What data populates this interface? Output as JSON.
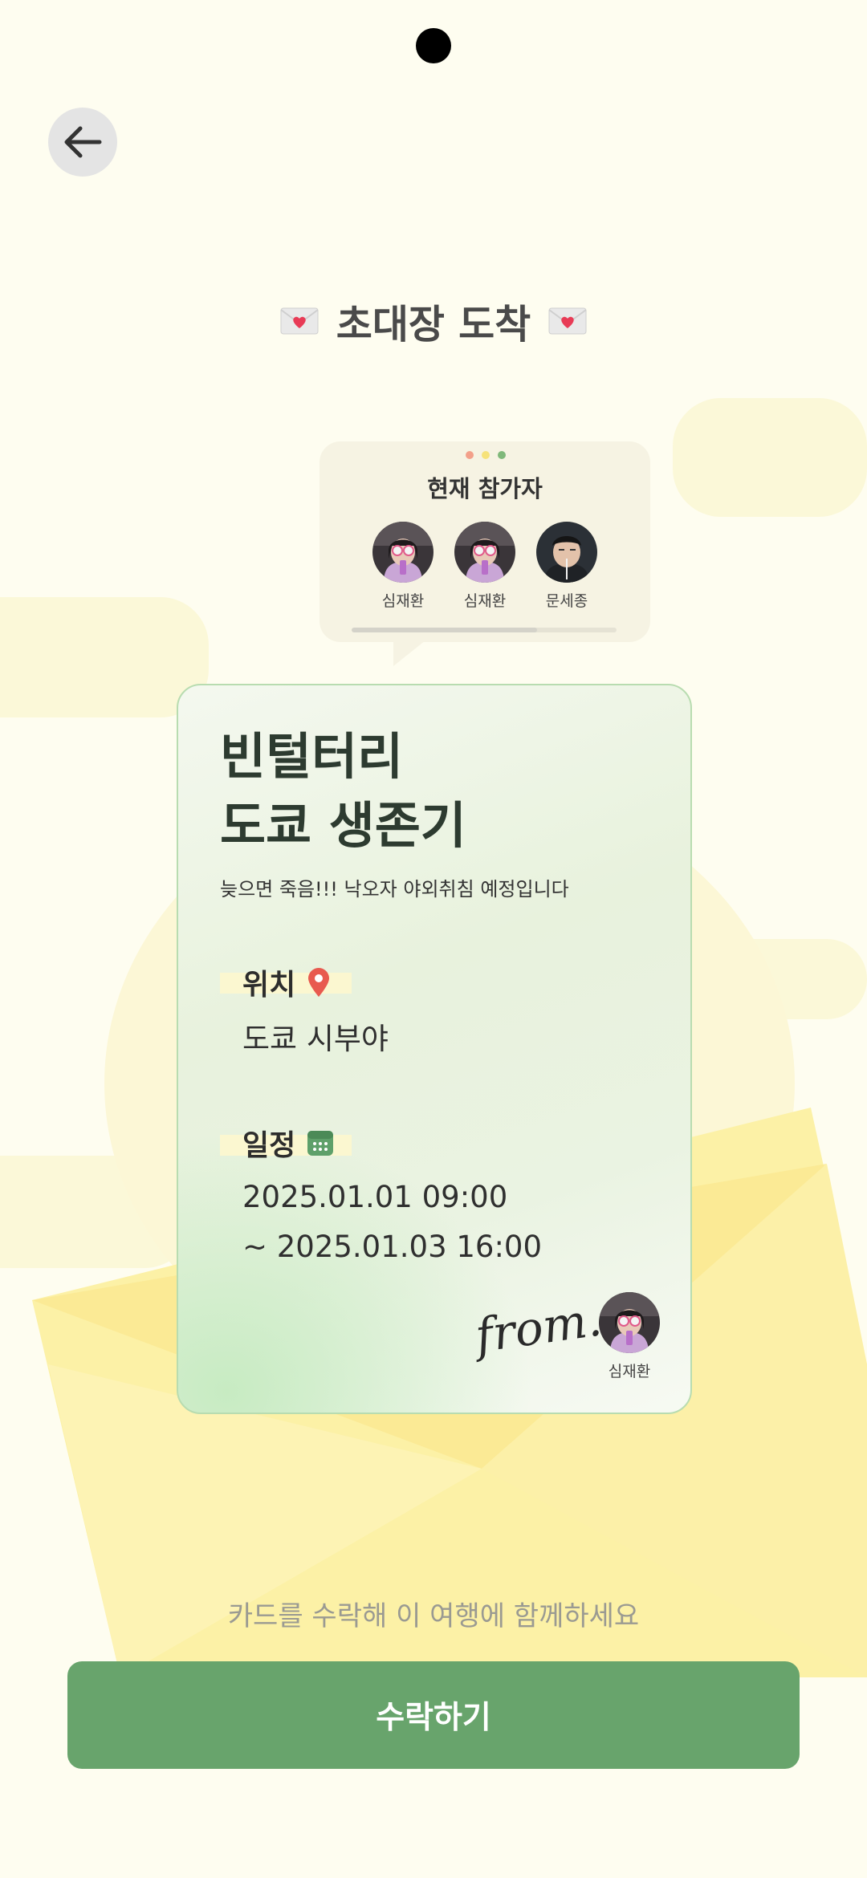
{
  "header": {
    "back_icon": "arrow-left-icon",
    "title": "초대장 도착",
    "title_icon": "love-letter-icon"
  },
  "participants": {
    "title": "현재 참가자",
    "people": [
      {
        "name": "심재환"
      },
      {
        "name": "심재환"
      },
      {
        "name": "문세종"
      }
    ],
    "dot_colors": [
      "#f3a08a",
      "#f6e27a",
      "#7fb87a"
    ]
  },
  "card": {
    "title_line1": "빈털터리",
    "title_line2": "도쿄 생존기",
    "subtitle": "늦으면 죽음!!! 낙오자 야외취침 예정입니다",
    "location_label": "위치",
    "location_icon": "map-pin-icon",
    "location_value": "도쿄 시부야",
    "schedule_label": "일정",
    "schedule_icon": "calendar-icon",
    "schedule_start": "2025.01.01 09:00",
    "schedule_end": "~ 2025.01.03 16:00",
    "from_label": "from.",
    "host_name": "심재환"
  },
  "footer": {
    "invite_text": "카드를 수락해 이 여행에 함께하세요",
    "accept_label": "수락하기"
  },
  "colors": {
    "background": "#fefdf0",
    "accent_green": "#68a46c",
    "card_border": "#b8dcb0"
  }
}
